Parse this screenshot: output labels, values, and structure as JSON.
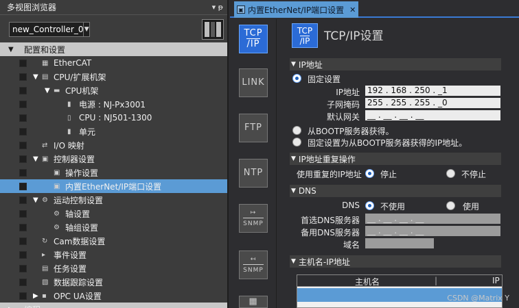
{
  "left_panel": {
    "title": "多视图浏览器",
    "pin": "▾ ᵽ",
    "controller_select": "new_Controller_0",
    "tree": [
      {
        "label": "配置和设置",
        "twisty": "▼",
        "level": 0,
        "type": "header"
      },
      {
        "label": "EtherCAT",
        "icon": "ethercat-icon",
        "glyph": "▦",
        "level": 1
      },
      {
        "label": "CPU/扩展机架",
        "twisty": "▼",
        "icon": "rack-icon",
        "glyph": "▤",
        "level": 1
      },
      {
        "label": "CPU机架",
        "twisty": "▼",
        "icon": "cpu-rack-icon",
        "glyph": "▬",
        "level": 2
      },
      {
        "label": "电源 : NJ-Px3001",
        "icon": "power-icon",
        "glyph": "▮",
        "level": 3
      },
      {
        "label": "CPU : NJ501-1300",
        "icon": "cpu-icon",
        "glyph": "▯",
        "level": 3
      },
      {
        "label": "单元",
        "icon": "unit-icon",
        "glyph": "▮",
        "level": 3
      },
      {
        "label": "I/O 映射",
        "icon": "io-map-icon",
        "glyph": "⇄",
        "level": 1
      },
      {
        "label": "控制器设置",
        "twisty": "▼",
        "icon": "controller-icon",
        "glyph": "▣",
        "level": 1
      },
      {
        "label": "操作设置",
        "icon": "operation-icon",
        "glyph": "▣",
        "level": 2
      },
      {
        "label": "内置EtherNet/IP端口设置",
        "icon": "ethernet-icon",
        "glyph": "▣",
        "level": 2,
        "selected": true
      },
      {
        "label": "运动控制设置",
        "twisty": "▼",
        "icon": "motion-icon",
        "glyph": "⚙",
        "level": 1
      },
      {
        "label": "轴设置",
        "icon": "axis-icon",
        "glyph": "⚙",
        "level": 2
      },
      {
        "label": "轴组设置",
        "icon": "axis-group-icon",
        "glyph": "⚙",
        "level": 2
      },
      {
        "label": "Cam数据设置",
        "icon": "cam-icon",
        "glyph": "↻",
        "level": 1
      },
      {
        "label": "事件设置",
        "icon": "event-icon",
        "glyph": "▸",
        "level": 1
      },
      {
        "label": "任务设置",
        "icon": "task-icon",
        "glyph": "▤",
        "level": 1
      },
      {
        "label": "数据跟踪设置",
        "icon": "trace-icon",
        "glyph": "▧",
        "level": 1
      },
      {
        "label": "OPC UA设置",
        "twisty": "▶",
        "icon": "opcua-icon",
        "glyph": "▪",
        "level": 1
      },
      {
        "label": "编程",
        "twisty": "▶",
        "level": 0,
        "type": "section"
      }
    ]
  },
  "tab": {
    "label": "内置EtherNet/IP端口设置",
    "close": "✕"
  },
  "nav": [
    {
      "l1": "TCP",
      "l2": "/IP",
      "name": "tcp-ip-nav-button",
      "active": true
    },
    {
      "l1": "LINK",
      "l2": "",
      "name": "link-nav-button"
    },
    {
      "l1": "FTP",
      "l2": "",
      "name": "ftp-nav-button"
    },
    {
      "l1": "NTP",
      "l2": "",
      "name": "ntp-nav-button"
    },
    {
      "l1": "↦",
      "l2": "SNMP",
      "name": "snmp-nav-button"
    },
    {
      "l1": "↤",
      "l2": "SNMP",
      "name": "snmp-trap-nav-button"
    },
    {
      "l1": "▦",
      "l2": "",
      "name": "more-nav-button"
    }
  ],
  "content": {
    "icon_l1": "TCP",
    "icon_l2": "/IP",
    "title": "TCP/IP设置",
    "ip_section": {
      "title": "IP地址",
      "fixed_label": "固定设置",
      "ip_label": "IP地址",
      "ip_value": "192 . 168 . 250 . _1",
      "mask_label": "子网掩码",
      "mask_value": "255 . 255 . 255 . _0",
      "gateway_label": "默认网关",
      "gateway_value": "__ . __ . __ . __",
      "bootp_label": "从BOOTP服务器获得。",
      "bootp_fixed_label": "固定设置为从BOOTP服务器获得的IP地址。"
    },
    "dup_section": {
      "title": "IP地址重复操作",
      "label": "使用重复的IP地址",
      "stop": "停止",
      "no_stop": "不停止"
    },
    "dns_section": {
      "title": "DNS",
      "label": "DNS",
      "unused": "不使用",
      "used": "使用",
      "primary_label": "首选DNS服务器",
      "primary_value": "__ . __ . __ . __",
      "secondary_label": "备用DNS服务器",
      "secondary_value": "__ . __ . __ . __",
      "domain_label": "域名",
      "domain_value": ""
    },
    "host_section": {
      "title": "主机名-IP地址",
      "col_host": "主机名",
      "col_ip": "IP"
    }
  },
  "watermark": "CSDN @Matrix Y"
}
